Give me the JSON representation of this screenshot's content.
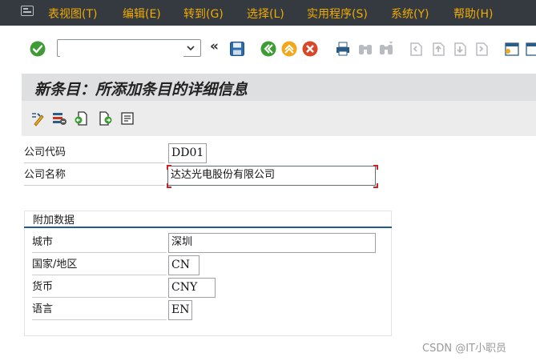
{
  "menu": {
    "items": [
      "表视图(T)",
      "编辑(E)",
      "转到(G)",
      "选择(L)",
      "实用程序(S)",
      "系统(Y)",
      "帮助(H)"
    ]
  },
  "toolbar": {
    "command_value": "",
    "nav_glyph": "«"
  },
  "screen": {
    "title": "新条目：所添加条目的详细信息"
  },
  "form": {
    "company_code_label": "公司代码",
    "company_code_value": "DD01",
    "company_name_label": "公司名称",
    "company_name_value": "达达光电股份有限公司"
  },
  "additional": {
    "title": "附加数据",
    "rows": [
      {
        "label": "城市",
        "value": "深圳"
      },
      {
        "label": "国家/地区",
        "value": "CN"
      },
      {
        "label": "货币",
        "value": "CNY"
      },
      {
        "label": "语言",
        "value": "EN"
      }
    ]
  },
  "watermark": "CSDN @IT小职员",
  "colors": {
    "menu_bg": "#353a40",
    "menu_text": "#f0ab00",
    "group_line": "#1f5e8c"
  }
}
